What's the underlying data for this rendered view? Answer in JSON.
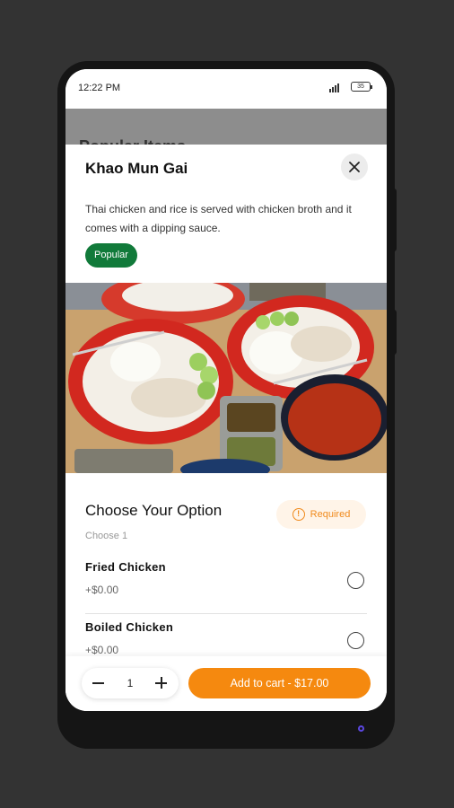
{
  "status_bar": {
    "time": "12:22 PM",
    "battery": "35"
  },
  "background_title": "Popular Items",
  "item": {
    "title": "Khao Mun Gai",
    "description": "Thai chicken and rice is served with chicken broth and it comes with a dipping sauce.",
    "badge": "Popular"
  },
  "options_section": {
    "title": "Choose Your Option",
    "subtitle": "Choose 1",
    "required_label": "Required",
    "options": [
      {
        "name": "Fried Chicken",
        "price": "+$0.00"
      },
      {
        "name": "Boiled Chicken",
        "price": "+$0.00"
      }
    ]
  },
  "footer": {
    "quantity": "1",
    "add_label": "Add to cart - $17.00"
  },
  "colors": {
    "accent": "#f5890f",
    "badge": "#117a3a"
  },
  "icons": {
    "close": "close-icon",
    "required": "info-icon",
    "minus": "minus-icon",
    "plus": "plus-icon"
  }
}
